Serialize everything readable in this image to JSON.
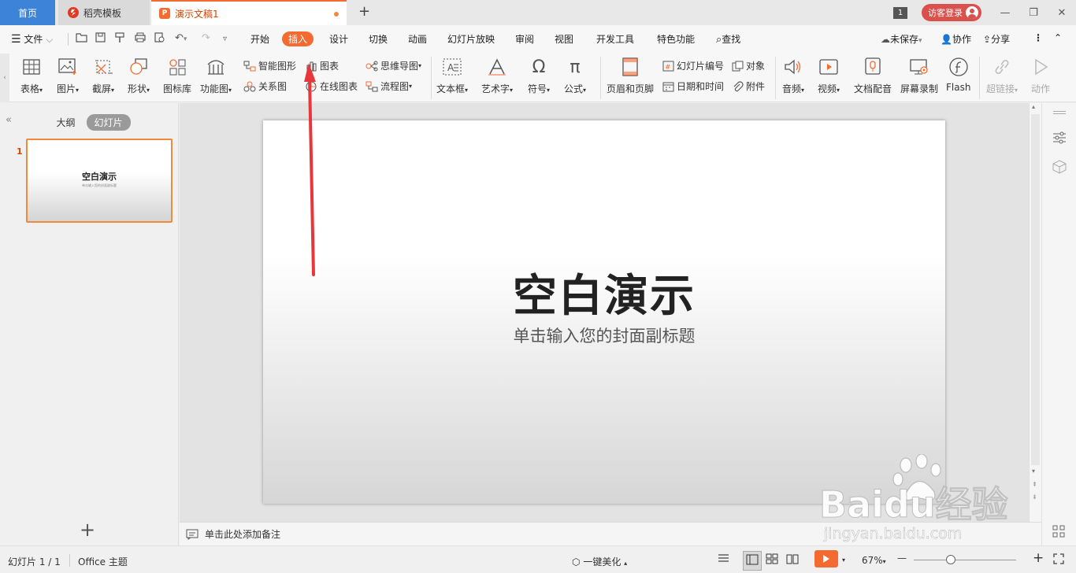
{
  "titlebar": {
    "tabs": [
      {
        "label": "首页"
      },
      {
        "label": "稻壳模板"
      },
      {
        "label": "演示文稿1"
      }
    ],
    "new_tab": "+",
    "window_count": "1",
    "login": "访客登录",
    "minimize": "—",
    "restore": "❐",
    "close": "✕"
  },
  "menubar": {
    "file": "文件",
    "items": [
      "开始",
      "插入",
      "设计",
      "切换",
      "动画",
      "幻灯片放映",
      "审阅",
      "视图",
      "开发工具",
      "特色功能"
    ],
    "active": "插入",
    "search": "查找",
    "unsaved": "未保存",
    "collab": "协作",
    "share": "分享"
  },
  "ribbon": {
    "table": "表格",
    "picture": "图片",
    "screenshot": "截屏",
    "shape": "形状",
    "icon_lib": "图标库",
    "func_chart": "功能图",
    "smartart": "智能图形",
    "chart": "图表",
    "relation": "关系图",
    "online_chart": "在线图表",
    "mindmap": "思维导图",
    "flowchart": "流程图",
    "textbox": "文本框",
    "wordart": "艺术字",
    "symbol": "符号",
    "formula": "公式",
    "header_footer": "页眉和页脚",
    "slide_number": "幻灯片编号",
    "object": "对象",
    "date_time": "日期和时间",
    "attachment": "附件",
    "audio": "音频",
    "video": "视频",
    "voiceover": "文档配音",
    "screen_record": "屏幕录制",
    "flash": "Flash",
    "hyperlink": "超链接",
    "action": "动作"
  },
  "left_pane": {
    "tab_outline": "大纲",
    "tab_slides": "幻灯片",
    "slide_number": "1",
    "thumb_title": "空白演示",
    "thumb_subtitle": "单击输入您的封面副标题",
    "add": "+"
  },
  "slide": {
    "title": "空白演示",
    "subtitle": "单击输入您的封面副标题"
  },
  "notes": {
    "placeholder": "单击此处添加备注"
  },
  "statusbar": {
    "slide_info": "幻灯片 1 / 1",
    "theme": "Office 主题",
    "beautify": "一键美化",
    "zoom": "67%",
    "zoom_minus": "—",
    "zoom_plus": "+"
  },
  "watermark": {
    "brand": "Baidu经验",
    "url": "jingyan.baidu.com"
  },
  "colors": {
    "accent": "#f46b32",
    "home_tab": "#3d83d8",
    "login": "#d9504c",
    "arrow": "#e8373a"
  }
}
